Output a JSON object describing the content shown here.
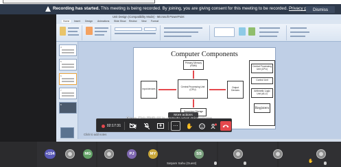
{
  "banner": {
    "title": "Recording has started.",
    "message": "This meeting is being recorded. By joining, you are giving consent for this meeting to be recorded.",
    "link": "Privacy policy",
    "dismiss": "Dismiss"
  },
  "powerpoint": {
    "window_title": "Unit Design (Compatibility Mode) - Microsoft PowerPoint",
    "title_badge": "Refresh Tools",
    "tabs": [
      "Home",
      "Insert",
      "Design",
      "Animations",
      "Slide Show",
      "Review",
      "View",
      "Format"
    ],
    "slide_numbers": [
      "4",
      "5",
      "6",
      "7",
      "8"
    ],
    "notes_placeholder": "Click to add notes",
    "slide": {
      "title": "Computer Components",
      "input": "Input devices",
      "output": "Output Devices",
      "memory": "Primary Memory (RAM)",
      "cpu": "Central Processing Unit (CPU)",
      "storage": "Secondary Storage",
      "cpu_panel": "Central Processing Unit (CPU)",
      "control": "Control Unit",
      "alu": "Arithmetic Logic Unit (ALU)",
      "registers": "Registers"
    }
  },
  "controls": {
    "timer": "02:17:31",
    "hint": "Press Ctrl+Shift+M to unmute your microphone",
    "more_tooltip": "More actions",
    "end_color": "#e5484d"
  },
  "participants": {
    "more_count": "+154",
    "tiles": [
      "MG",
      "PJ",
      "MY",
      "SS"
    ],
    "speaker_name": "Satyam Sahu (Guest)"
  },
  "icons": [
    "warning-icon",
    "camera-off-icon",
    "mic-off-icon",
    "share-icon",
    "more-icon",
    "hand-icon",
    "reactions-icon",
    "people-icon",
    "hang-up-icon"
  ]
}
